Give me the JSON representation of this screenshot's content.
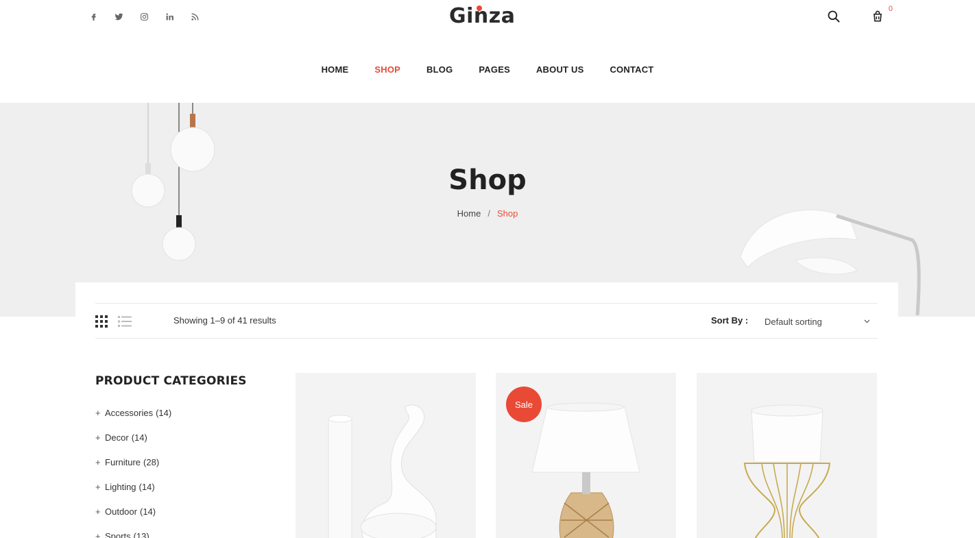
{
  "header": {
    "social": [
      {
        "icon": "facebook-icon"
      },
      {
        "icon": "twitter-icon"
      },
      {
        "icon": "instagram-icon"
      },
      {
        "icon": "linkedin-icon"
      },
      {
        "icon": "rss-icon"
      }
    ],
    "logo_text": "Ginza",
    "cart_count": "0",
    "nav": [
      {
        "label": "HOME",
        "active": false
      },
      {
        "label": "SHOP",
        "active": true
      },
      {
        "label": "BLOG",
        "active": false
      },
      {
        "label": "PAGES",
        "active": false
      },
      {
        "label": "ABOUT US",
        "active": false
      },
      {
        "label": "CONTACT",
        "active": false
      }
    ]
  },
  "hero": {
    "title": "Shop",
    "breadcrumb": {
      "home": "Home",
      "separator": "/",
      "current": "Shop"
    }
  },
  "toolbar": {
    "results_text": "Showing 1–9 of 41 results",
    "sort_label": "Sort By :",
    "sort_value": "Default sorting"
  },
  "sidebar": {
    "title": "PRODUCT CATEGORIES",
    "categories": [
      {
        "name": "Accessories",
        "count": "(14)"
      },
      {
        "name": "Decor",
        "count": "(14)"
      },
      {
        "name": "Furniture",
        "count": "(28)"
      },
      {
        "name": "Lighting",
        "count": "(14)"
      },
      {
        "name": "Outdoor",
        "count": "(14)"
      },
      {
        "name": "Sports",
        "count": "(13)"
      }
    ]
  },
  "products": {
    "sale_badge": "Sale"
  },
  "colors": {
    "accent": "#e94a35",
    "hero_bg": "#efefef",
    "text": "#222222"
  }
}
